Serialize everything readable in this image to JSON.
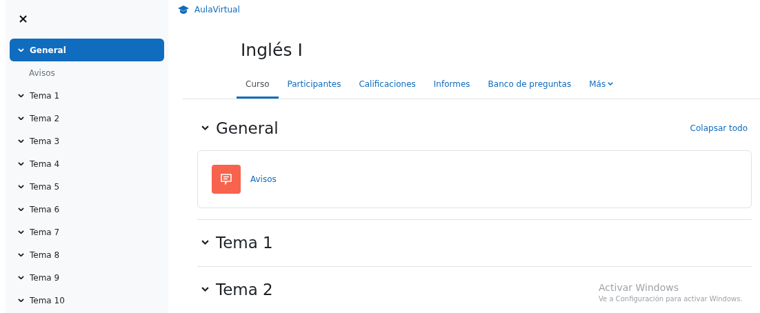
{
  "sidebar": {
    "close": "×",
    "items": [
      {
        "label": "General",
        "kind": "section",
        "selected": true
      },
      {
        "label": "Avisos",
        "kind": "activity",
        "selected": false
      },
      {
        "label": "Tema 1",
        "kind": "section",
        "selected": false
      },
      {
        "label": "Tema 2",
        "kind": "section",
        "selected": false
      },
      {
        "label": "Tema 3",
        "kind": "section",
        "selected": false
      },
      {
        "label": "Tema 4",
        "kind": "section",
        "selected": false
      },
      {
        "label": "Tema 5",
        "kind": "section",
        "selected": false
      },
      {
        "label": "Tema 6",
        "kind": "section",
        "selected": false
      },
      {
        "label": "Tema 7",
        "kind": "section",
        "selected": false
      },
      {
        "label": "Tema 8",
        "kind": "section",
        "selected": false
      },
      {
        "label": "Tema 9",
        "kind": "section",
        "selected": false
      },
      {
        "label": "Tema 10",
        "kind": "section",
        "selected": false
      }
    ]
  },
  "brand": "AulaVirtual",
  "course_title": "Inglés I",
  "tabs": [
    {
      "label": "Curso",
      "selected": true
    },
    {
      "label": "Participantes",
      "selected": false
    },
    {
      "label": "Calificaciones",
      "selected": false
    },
    {
      "label": "Informes",
      "selected": false
    },
    {
      "label": "Banco de preguntas",
      "selected": false
    },
    {
      "label": "Más",
      "selected": false,
      "dropdown": true
    }
  ],
  "collapse_all": "Colapsar todo",
  "sections": [
    {
      "title": "General",
      "activities": [
        {
          "label": "Avisos"
        }
      ]
    },
    {
      "title": "Tema 1"
    },
    {
      "title": "Tema 2"
    }
  ],
  "windows_notice": {
    "title": "Activar Windows",
    "text": "Ve a Configuración para activar Windows."
  }
}
